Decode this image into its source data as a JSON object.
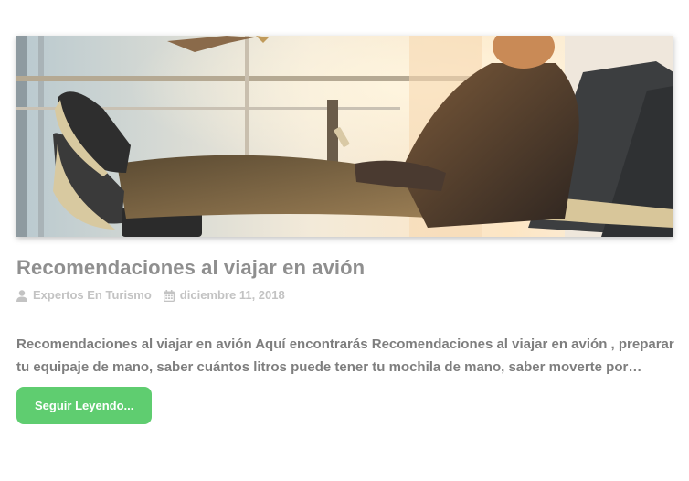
{
  "post": {
    "title": "Recomendaciones al viajar en avión",
    "author": "Expertos En Turismo",
    "date": "diciembre 11, 2018",
    "excerpt": "Recomendaciones al viajar en avión Aquí encontrarás Recomendaciones al viajar en avión , preparar tu equipaje de mano, saber cuántos litros puede tener tu mochila de mano, saber moverte por…",
    "read_more_label": "Seguir Leyendo..."
  },
  "icons": {
    "author": "user-icon",
    "date": "calendar-icon"
  },
  "colors": {
    "button": "#5fcd70",
    "title": "#8f8f8f",
    "meta": "#c3c3c3",
    "excerpt": "#7e7e7e"
  }
}
